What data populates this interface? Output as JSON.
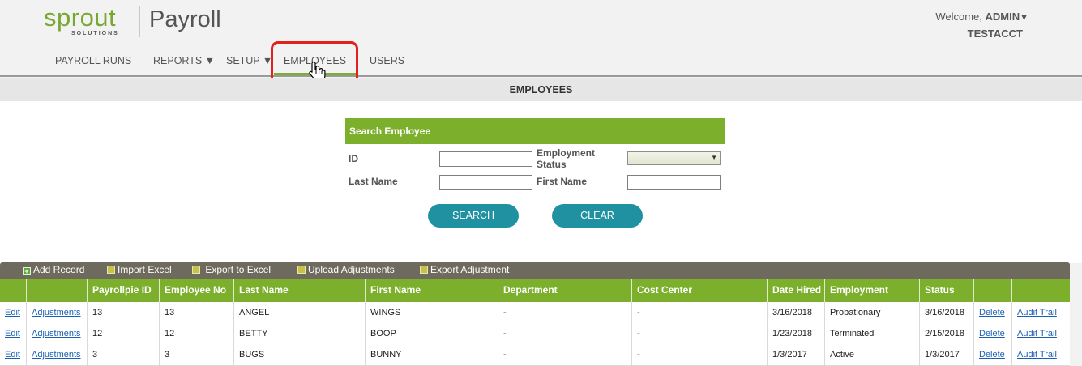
{
  "brand": {
    "logo_word": "sprout",
    "logo_sub": "SOLUTIONS",
    "product": "Payroll",
    "color": "#79a832"
  },
  "user": {
    "welcome": "Welcome,",
    "name": "ADMIN",
    "account": "TESTACCT",
    "dropdown_icon": "caret-down-icon"
  },
  "nav": {
    "items": [
      {
        "label": "PAYROLL RUNS"
      },
      {
        "label": "REPORTS ▼"
      },
      {
        "label": "SETUP ▼"
      },
      {
        "label": "EMPLOYEES"
      },
      {
        "label": "USERS"
      }
    ],
    "active_index": 3,
    "highlight_color": "#e3211c"
  },
  "page": {
    "title": "EMPLOYEES"
  },
  "search": {
    "title": "Search Employee",
    "id_label": "ID",
    "id_value": "",
    "status_label_line1": "Employment",
    "status_label_line2": "Status",
    "status_value": "",
    "last_name_label": "Last Name",
    "last_name_value": "",
    "first_name_label": "First Name",
    "first_name_value": "",
    "search_button": "SEARCH",
    "clear_button": "CLEAR"
  },
  "toolbar": {
    "add_record": "Add Record",
    "import_excel": "Import Excel",
    "export_excel": "Export to Excel",
    "upload_adjustments": "Upload Adjustments",
    "export_adjustment": "Export Adjustment"
  },
  "table": {
    "columns": [
      "",
      "",
      "Payrollpie ID",
      "Employee No",
      "Last Name",
      "First Name",
      "Department",
      "Cost Center",
      "Date Hired",
      "Employment Status",
      "Status",
      "",
      ""
    ],
    "rows": [
      {
        "edit": "Edit",
        "adjustments": "Adjustments",
        "payrollpie_id": "13",
        "employee_no": "13",
        "last_name": "ANGEL",
        "first_name": "WINGS",
        "department": "-",
        "cost_center": "-",
        "date_hired": "3/16/2018",
        "employment_status": "Probationary",
        "status": "3/16/2018",
        "delete": "Delete",
        "audit": "Audit Trail"
      },
      {
        "edit": "Edit",
        "adjustments": "Adjustments",
        "payrollpie_id": "12",
        "employee_no": "12",
        "last_name": "BETTY",
        "first_name": "BOOP",
        "department": "-",
        "cost_center": "-",
        "date_hired": "1/23/2018",
        "employment_status": "Terminated",
        "status": "2/15/2018",
        "delete": "Delete",
        "audit": "Audit Trail"
      },
      {
        "edit": "Edit",
        "adjustments": "Adjustments",
        "payrollpie_id": "3",
        "employee_no": "3",
        "last_name": "BUGS",
        "first_name": "BUNNY",
        "department": "-",
        "cost_center": "-",
        "date_hired": "1/3/2017",
        "employment_status": "Active",
        "status": "1/3/2017",
        "delete": "Delete",
        "audit": "Audit Trail"
      }
    ]
  },
  "colors": {
    "accent_green": "#7cb02c",
    "button_teal": "#1f91a1",
    "link_blue": "#1a5fb4"
  }
}
